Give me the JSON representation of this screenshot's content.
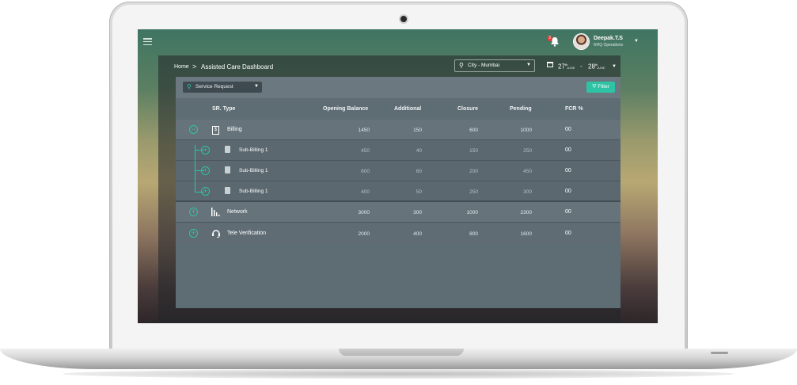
{
  "header": {
    "notification_count": "3",
    "user_name": "Deepak.T.S",
    "user_role": "NHQ Operations"
  },
  "breadcrumb": {
    "home": "Home",
    "separator": ">",
    "current": "Assisted Care Dashboard"
  },
  "filters": {
    "city": "City - Mumbai",
    "date_from_day": "27",
    "date_from_suffix": "th",
    "date_from_month": "JUNE",
    "date_to_day": "28",
    "date_to_suffix": "th",
    "date_to_month": "JUNE",
    "date_sep": "-",
    "service_request": "Service Request",
    "filter_label": "Filter"
  },
  "table": {
    "columns": [
      "SR. Type",
      "Opening Balance",
      "Additional",
      "Closure",
      "Pending",
      "FCR %"
    ],
    "rows": [
      {
        "name": "Billing",
        "icon": "billing-icon",
        "toggle": "−",
        "opening": "1450",
        "additional": "150",
        "closure": "600",
        "pending": "1000",
        "fcr": "00"
      },
      {
        "name": "Sub-Billing 1",
        "icon": "document-icon",
        "toggle": "+",
        "opening": "450",
        "additional": "40",
        "closure": "150",
        "pending": "250",
        "fcr": "00"
      },
      {
        "name": "Sub-Billing 1",
        "icon": "document-icon",
        "toggle": "+",
        "opening": "600",
        "additional": "60",
        "closure": "200",
        "pending": "450",
        "fcr": "00"
      },
      {
        "name": "Sub-Billing 1",
        "icon": "document-icon",
        "toggle": "+",
        "opening": "400",
        "additional": "50",
        "closure": "250",
        "pending": "300",
        "fcr": "00"
      },
      {
        "name": "Network",
        "icon": "signal-icon",
        "toggle": "+",
        "opening": "3000",
        "additional": "300",
        "closure": "1000",
        "pending": "2300",
        "fcr": "00"
      },
      {
        "name": "Tele Verification",
        "icon": "headset-icon",
        "toggle": "+",
        "opening": "2000",
        "additional": "400",
        "closure": "800",
        "pending": "1600",
        "fcr": "00"
      }
    ]
  },
  "colors": {
    "accent": "#2fc3a5",
    "card": "#5e6c74"
  }
}
